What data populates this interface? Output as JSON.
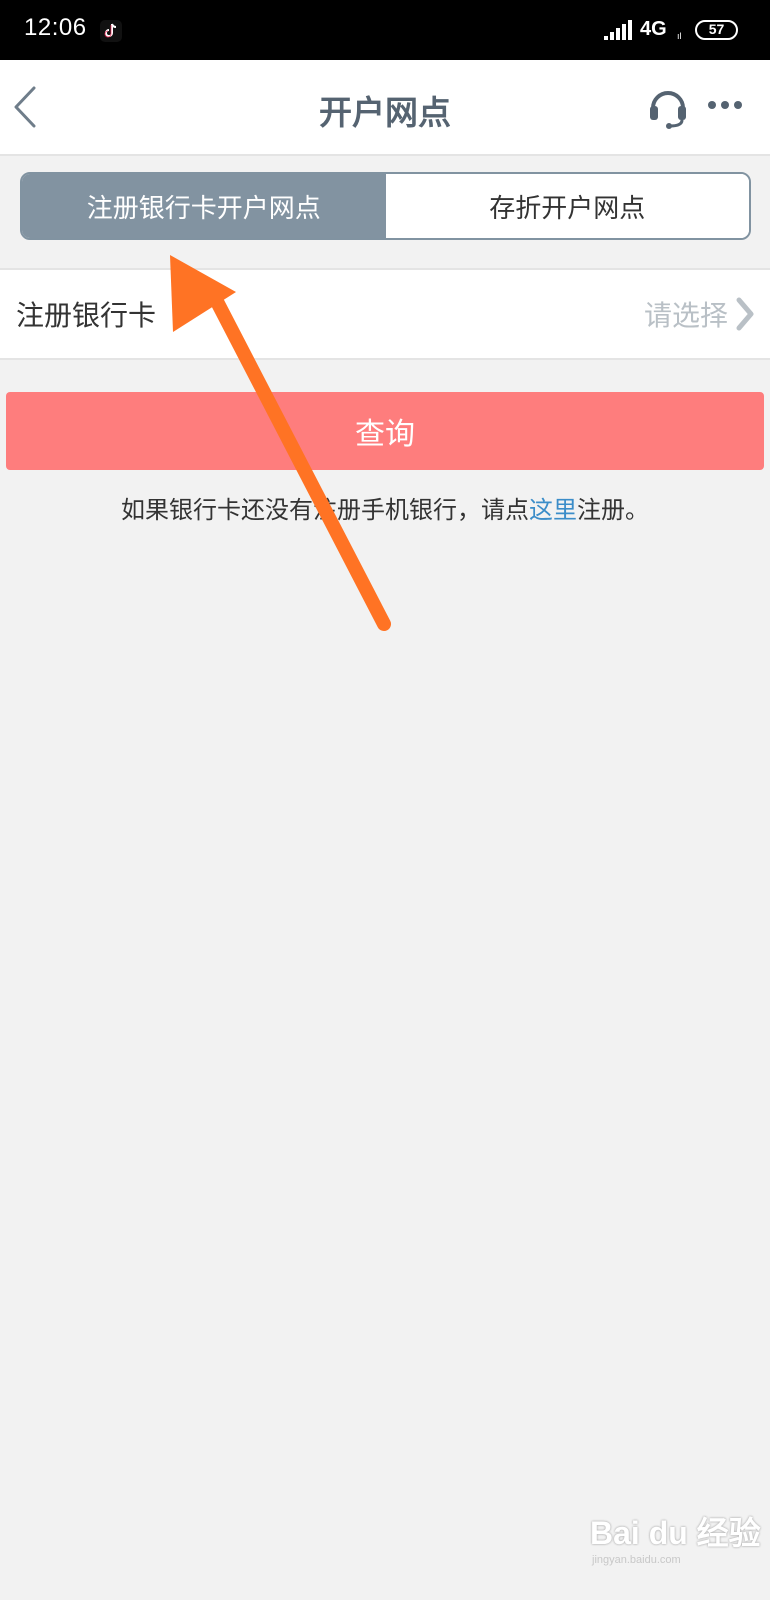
{
  "status_bar": {
    "time": "12:06",
    "network": "4G",
    "network_sub": "ıl",
    "battery": "57"
  },
  "nav": {
    "title": "开户网点"
  },
  "tabs": [
    {
      "label": "注册银行卡开户网点",
      "active": true
    },
    {
      "label": "存折开户网点",
      "active": false
    }
  ],
  "form": {
    "card_label": "注册银行卡",
    "card_value": "请选择"
  },
  "actions": {
    "query_label": "查询"
  },
  "hint": {
    "prefix": "如果银行卡还没有注册手机银行，请点",
    "link": "这里",
    "suffix": "注册。"
  },
  "colors": {
    "tab_active": "#8293a1",
    "query_button": "#fe7d7d",
    "link": "#3b8dc9",
    "annotation_arrow": "#ff7324"
  },
  "watermark": {
    "logo": "Bai du 经验",
    "url": "jingyan.baidu.com"
  }
}
